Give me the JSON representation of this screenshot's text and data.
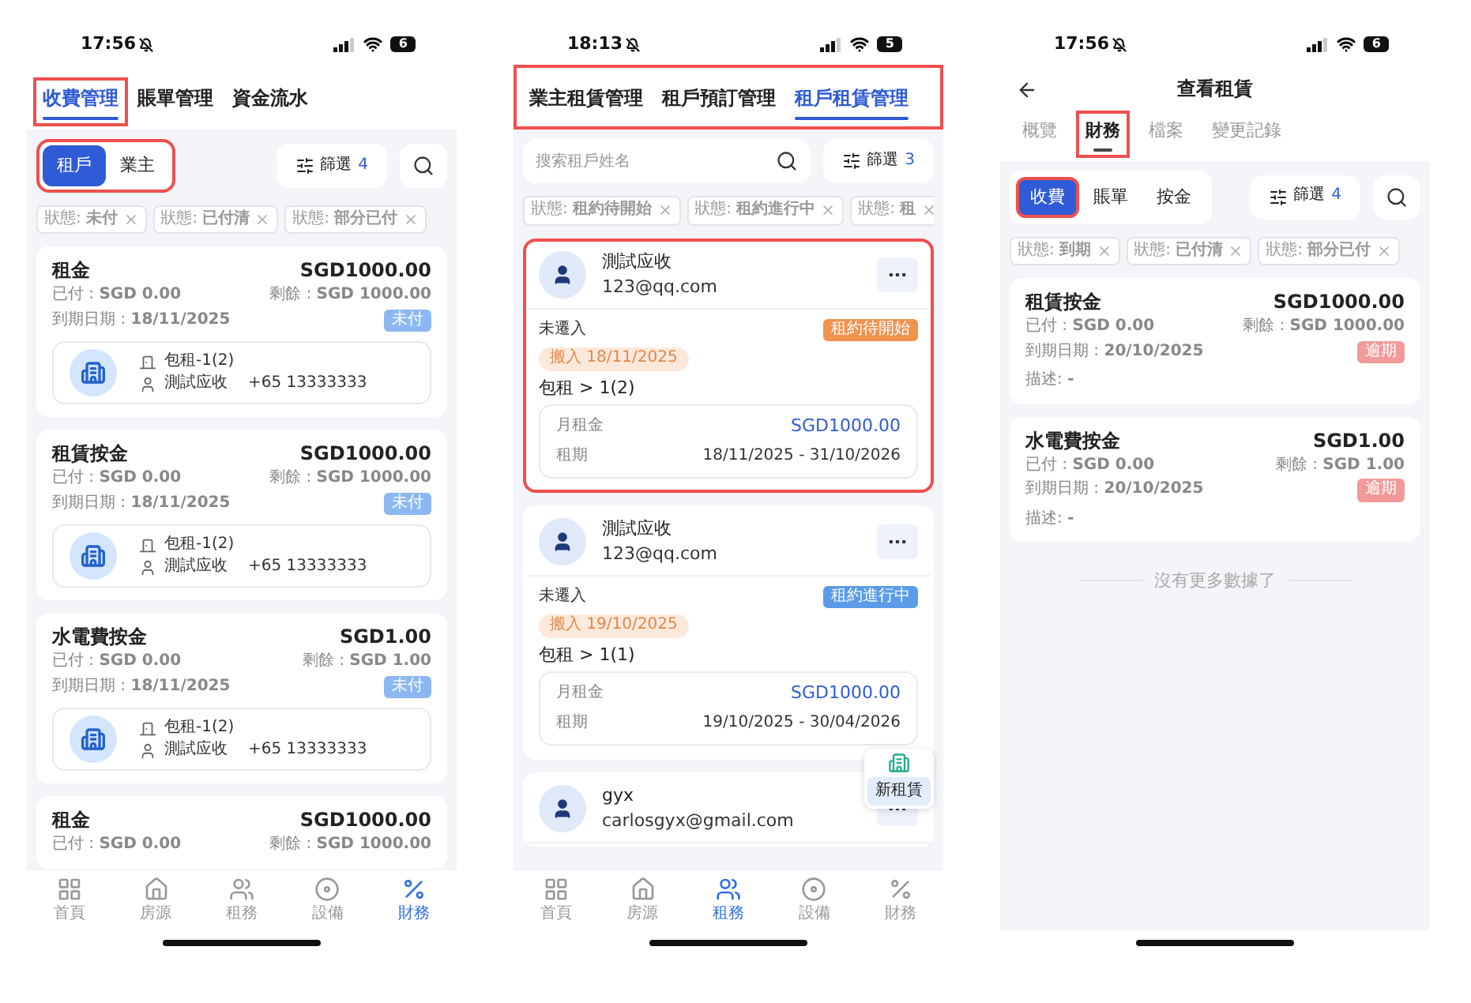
{
  "screens": [
    {
      "kind": "fee_list",
      "status_bar": {
        "time": "17:56",
        "battery": "6"
      },
      "tabs": {
        "highlighted": false,
        "items": [
          {
            "label": "收費管理",
            "selected": true,
            "highlighted": true
          },
          {
            "label": "賬單管理",
            "selected": false,
            "highlighted": false
          },
          {
            "label": "資金流水",
            "selected": false,
            "highlighted": false
          }
        ]
      },
      "segments": {
        "highlighted": true,
        "items": [
          {
            "label": "租戶",
            "selected": true,
            "highlighted": false
          },
          {
            "label": "業主",
            "selected": false,
            "highlighted": false
          }
        ]
      },
      "filter": {
        "label": "篩選",
        "count": "4"
      },
      "chips": [
        "狀態: **未付**",
        "狀態: **已付清**",
        "狀態: **部分已付**"
      ],
      "cards": [
        {
          "title": "租金",
          "amount": "SGD1000.00",
          "paid": "已付 : **SGD 0.00**",
          "remaining": "剩餘 : **SGD 1000.00**",
          "due": "到期日期 : **18/11/2025**",
          "badge": {
            "label": "未付",
            "color": "#8cb8f2"
          },
          "unit": "包租-1(2)",
          "contact": "測試应收",
          "phone": "+65 13333333"
        },
        {
          "title": "租賃按金",
          "amount": "SGD1000.00",
          "paid": "已付 : **SGD 0.00**",
          "remaining": "剩餘 : **SGD 1000.00**",
          "due": "到期日期 : **18/11/2025**",
          "badge": {
            "label": "未付",
            "color": "#8cb8f2"
          },
          "unit": "包租-1(2)",
          "contact": "測試应收",
          "phone": "+65 13333333"
        },
        {
          "title": "水電費按金",
          "amount": "SGD1.00",
          "paid": "已付 : **SGD 0.00**",
          "remaining": "剩餘 : **SGD 1.00**",
          "due": "到期日期 : **18/11/2025**",
          "badge": {
            "label": "未付",
            "color": "#8cb8f2"
          },
          "unit": "包租-1(2)",
          "contact": "測試应收",
          "phone": "+65 13333333"
        },
        {
          "title": "租金",
          "amount": "SGD1000.00",
          "paid": "已付 : **SGD 0.00**",
          "remaining": "剩餘 : **SGD 1000.00**"
        }
      ],
      "nav": [
        {
          "label": "首頁",
          "selected": false
        },
        {
          "label": "房源",
          "selected": false
        },
        {
          "label": "租務",
          "selected": false
        },
        {
          "label": "設備",
          "selected": false
        },
        {
          "label": "財務",
          "selected": true
        }
      ]
    },
    {
      "kind": "lease_list",
      "status_bar": {
        "time": "18:13",
        "battery": "5"
      },
      "tabs": {
        "highlighted": true,
        "items": [
          {
            "label": "業主租賃管理",
            "selected": false,
            "highlighted": false
          },
          {
            "label": "租戶預訂管理",
            "selected": false,
            "highlighted": false
          },
          {
            "label": "租戶租賃管理",
            "selected": true,
            "highlighted": false
          }
        ]
      },
      "search": {
        "placeholder": "搜索租戶姓名"
      },
      "filter": {
        "label": "篩選",
        "count": "3"
      },
      "chips": [
        "狀態: **租約待開始**",
        "狀態: **租約進行中**",
        "狀態: **租**"
      ],
      "leases": [
        {
          "name": "測試应收",
          "email": "123@qq.com",
          "highlighted": true,
          "move_state": "未遷入",
          "status": {
            "label": "租約待開始",
            "color": "#f0934f"
          },
          "move_in": "搬入 18/11/2025",
          "property": "包租 > 1(2)",
          "rent_label": "月租金",
          "rent": "SGD1000.00",
          "term_label": "租期",
          "term": "18/11/2025 - 31/10/2026"
        },
        {
          "name": "測試应收",
          "email": "123@qq.com",
          "highlighted": false,
          "move_state": "未遷入",
          "status": {
            "label": "租約進行中",
            "color": "#5b9be8"
          },
          "move_in": "搬入 19/10/2025",
          "property": "包租 > 1(1)",
          "rent_label": "月租金",
          "rent": "SGD1000.00",
          "term_label": "租期",
          "term": "19/10/2025 - 30/04/2026"
        },
        {
          "name": "gyx",
          "email": "carlosgyx@gmail.com",
          "highlighted": false
        }
      ],
      "fab": {
        "label": "新租賃"
      },
      "nav": [
        {
          "label": "首頁",
          "selected": false
        },
        {
          "label": "房源",
          "selected": false
        },
        {
          "label": "租務",
          "selected": true
        },
        {
          "label": "設備",
          "selected": false
        },
        {
          "label": "財務",
          "selected": false
        }
      ]
    },
    {
      "kind": "lease_detail",
      "status_bar": {
        "time": "17:56",
        "battery": "6"
      },
      "title": "查看租賃",
      "tabs": {
        "highlighted": false,
        "items": [
          {
            "label": "概覽",
            "selected": false,
            "highlighted": false
          },
          {
            "label": "財務",
            "selected": true,
            "highlighted": true
          },
          {
            "label": "檔案",
            "selected": false,
            "highlighted": false
          },
          {
            "label": "變更記錄",
            "selected": false,
            "highlighted": false
          }
        ]
      },
      "segments": {
        "highlighted": false,
        "items": [
          {
            "label": "收費",
            "selected": true,
            "highlighted": true
          },
          {
            "label": "賬單",
            "selected": false,
            "highlighted": false
          },
          {
            "label": "按金",
            "selected": false,
            "highlighted": false
          }
        ]
      },
      "filter": {
        "label": "篩選",
        "count": "4"
      },
      "chips": [
        "狀態: **到期**",
        "狀態: **已付清**",
        "狀態: **部分已付**"
      ],
      "cards": [
        {
          "title": "租賃按金",
          "amount": "SGD1000.00",
          "paid": "已付 : **SGD 0.00**",
          "remaining": "剩餘 : **SGD 1000.00**",
          "due": "到期日期 : **20/10/2025**",
          "badge": {
            "label": "逾期",
            "color": "#f29a9a"
          },
          "note": "描述:  **-**"
        },
        {
          "title": "水電費按金",
          "amount": "SGD1.00",
          "paid": "已付 : **SGD 0.00**",
          "remaining": "剩餘 : **SGD 1.00**",
          "due": "到期日期 : **20/10/2025**",
          "badge": {
            "label": "逾期",
            "color": "#f29a9a"
          },
          "note": "描述:  **-**"
        }
      ],
      "end_text": "沒有更多數據了"
    }
  ]
}
